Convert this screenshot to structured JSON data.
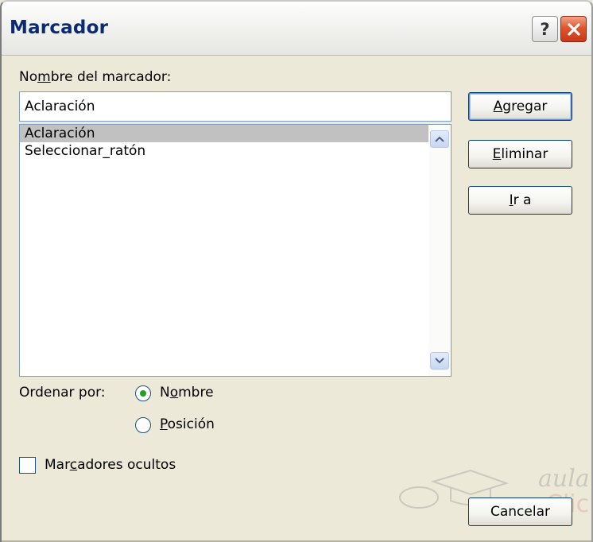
{
  "window": {
    "title": "Marcador"
  },
  "titlebar": {
    "help_label": "?",
    "close_icon": "close-icon"
  },
  "name_field": {
    "label_pre": "No",
    "label_mnemonic": "m",
    "label_post": "bre del marcador:",
    "value": "Aclaración"
  },
  "bookmarks": {
    "items": [
      {
        "label": "Aclaración",
        "selected": true
      },
      {
        "label": "Seleccionar_ratón",
        "selected": false
      }
    ]
  },
  "buttons": {
    "add": {
      "mnemonic": "A",
      "rest": "gregar"
    },
    "delete": {
      "mnemonic": "E",
      "rest": "liminar"
    },
    "goto": {
      "mnemonic": "I",
      "rest": "r a"
    },
    "cancel": {
      "label": "Cancelar"
    }
  },
  "sort": {
    "label": "Ordenar por:",
    "name": {
      "pre": "N",
      "mnemonic": "o",
      "post": "mbre",
      "checked": true
    },
    "position": {
      "pre": "",
      "mnemonic": "P",
      "post": "osición",
      "checked": false
    }
  },
  "hidden": {
    "pre": "Mar",
    "mnemonic": "c",
    "post": "adores ocultos",
    "checked": false
  },
  "watermark": {
    "text": "aulaClic"
  },
  "colors": {
    "title_text": "#0b2a74",
    "selected_row": "#c1c1c1",
    "radio_dot": "#21a121",
    "close_button": "#d9452a"
  }
}
